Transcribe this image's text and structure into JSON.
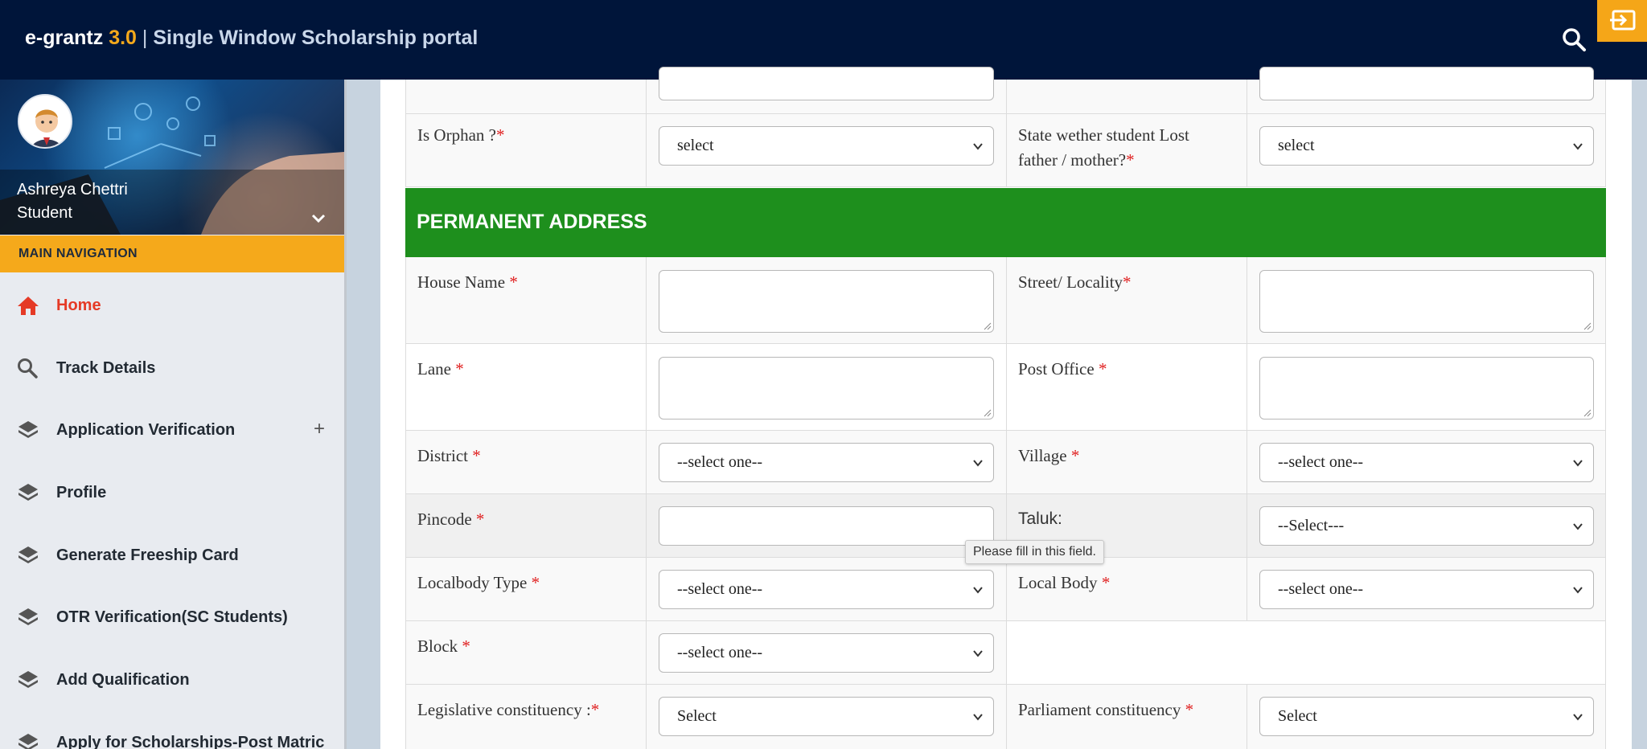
{
  "app": {
    "brand_name": "e-grantz",
    "brand_version": "3.0",
    "brand_separator": "|",
    "brand_subtitle": "Single Window Scholarship portal",
    "accent_color": "#f5a91b",
    "header_color": "#00153a",
    "section_color": "#1e8f1d"
  },
  "header": {
    "search_icon": "search-icon",
    "logout_icon": "logout-icon"
  },
  "user": {
    "name": "Ashreya Chettri",
    "role": "Student"
  },
  "sidebar": {
    "nav_header": "MAIN NAVIGATION",
    "items": [
      {
        "label": "Home",
        "icon": "home-icon",
        "active": true
      },
      {
        "label": "Track Details",
        "icon": "search-icon"
      },
      {
        "label": "Application Verification",
        "icon": "layers-icon",
        "expand": "+"
      },
      {
        "label": "Profile",
        "icon": "layers-icon"
      },
      {
        "label": "Generate Freeship Card",
        "icon": "layers-icon"
      },
      {
        "label": "OTR Verification(SC Students)",
        "icon": "layers-icon"
      },
      {
        "label": "Add Qualification",
        "icon": "layers-icon"
      },
      {
        "label": "Apply for Scholarships-Post Matric",
        "icon": "layers-icon"
      }
    ]
  },
  "form": {
    "orphan_label": "Is Orphan ?",
    "orphan_value": "select",
    "lost_parent_label_1": "State wether student Lost",
    "lost_parent_label_2": "father / mother?",
    "lost_parent_value": "select",
    "section_title": "PERMANENT ADDRESS",
    "house_name_label": "House Name ",
    "street_label": "Street/ Locality",
    "lane_label": "Lane ",
    "post_office_label": "Post Office ",
    "district_label": "District ",
    "district_value": "--select one--",
    "village_label": "Village ",
    "village_value": "--select one--",
    "pincode_label": "Pincode ",
    "taluk_label": "Taluk:",
    "taluk_value": "--Select---",
    "localbody_type_label": "Localbody Type ",
    "localbody_type_value": "--select one--",
    "local_body_label": "Local Body ",
    "local_body_value": "--select one--",
    "block_label": "Block ",
    "block_value": "--select one--",
    "legislative_label": "Legislative constituency :",
    "legislative_value": "Select",
    "parliament_label": "Parliament constituency ",
    "parliament_value": "Select",
    "required_mark": "*",
    "validation_tooltip": "Please fill in this field."
  }
}
